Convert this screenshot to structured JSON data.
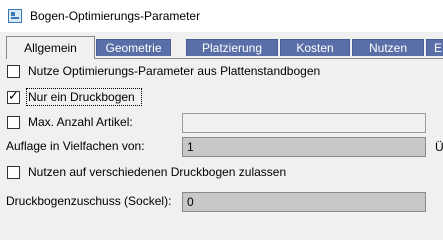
{
  "window": {
    "title": "Bogen-Optimierungs-Parameter",
    "icon": "app-window-icon"
  },
  "tabs": [
    {
      "label": "Allgemein",
      "active": true
    },
    {
      "label": "Geometrie",
      "active": false
    },
    {
      "label": "Platzierung",
      "active": false
    },
    {
      "label": "Kosten",
      "active": false
    },
    {
      "label": "Nutzen",
      "active": false
    },
    {
      "label": "E",
      "active": false
    }
  ],
  "options": {
    "use_sheet_params": {
      "label": "Nutze Optimierungs-Parameter aus Plattenstandbogen",
      "checked": false
    },
    "single_sheet": {
      "label": "Nur ein Druckbogen",
      "checked": true
    },
    "max_items": {
      "label": "Max. Anzahl Artikel:",
      "checked": false,
      "value": ""
    },
    "multiple_of": {
      "label": "Auflage in Vielfachen von:",
      "value": "1",
      "suffix": "Ü"
    },
    "multi_sheet_allow": {
      "label": "Nutzen auf verschiedenen Druckbogen zulassen",
      "checked": false
    },
    "sheet_allowance": {
      "label": "Druckbogenzuschuss (Sockel):",
      "value": "0"
    }
  }
}
